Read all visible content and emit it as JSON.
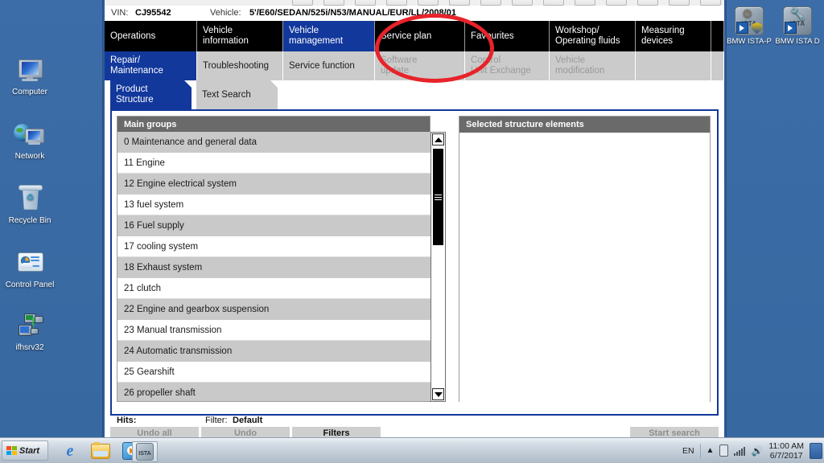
{
  "desktop": {
    "icons_left": [
      {
        "label": "Computer",
        "icon": "computer-icon"
      },
      {
        "label": "Network",
        "icon": "network-icon"
      },
      {
        "label": "Recycle Bin",
        "icon": "recycle-bin-icon"
      },
      {
        "label": "Control Panel",
        "icon": "control-panel-icon"
      },
      {
        "label": "ifhsrv32",
        "icon": "server-shortcut-icon"
      }
    ],
    "icons_right": [
      {
        "label": "BMW ISTA-P",
        "icon": "bmw-ista-p-icon",
        "badge": "ISTA"
      },
      {
        "label": "BMW ISTA D",
        "icon": "bmw-ista-d-icon",
        "badge": "ISTA"
      }
    ]
  },
  "app": {
    "vin_label": "VIN:",
    "vin_value": "CJ95542",
    "vehicle_label": "Vehicle:",
    "vehicle_value": "5'/E60/SEDAN/525i/N53/MANUAL/EUR/LL/2008/01",
    "tabs_main": [
      {
        "label": "Operations",
        "selected": false,
        "disabled": false
      },
      {
        "label": "Vehicle information",
        "selected": false,
        "disabled": false
      },
      {
        "label": "Vehicle management",
        "selected": true,
        "disabled": false
      },
      {
        "label": "Service plan",
        "selected": false,
        "disabled": false
      },
      {
        "label": "Favourites",
        "selected": false,
        "disabled": false
      },
      {
        "label": "Workshop/ Operating fluids",
        "selected": false,
        "disabled": false
      },
      {
        "label": "Measuring devices",
        "selected": false,
        "disabled": false
      }
    ],
    "tabs_sub": [
      {
        "label": "Repair/ Maintenance",
        "selected": true,
        "disabled": false
      },
      {
        "label": "Troubleshooting",
        "selected": false,
        "disabled": false
      },
      {
        "label": "Service function",
        "selected": false,
        "disabled": false
      },
      {
        "label": "Software update",
        "selected": false,
        "disabled": true
      },
      {
        "label": "Control Unit Exchange",
        "selected": false,
        "disabled": true
      },
      {
        "label": "Vehicle modification",
        "selected": false,
        "disabled": true
      }
    ],
    "tabs_inner": [
      {
        "label": "Product Structure",
        "selected": true
      },
      {
        "label": "Text Search",
        "selected": false
      }
    ],
    "left_panel": {
      "header": "Main groups",
      "rows": [
        "0 Maintenance and general data",
        "11 Engine",
        "12 Engine electrical system",
        "13 fuel system",
        "16 Fuel supply",
        "17 cooling system",
        "18 Exhaust system",
        "21 clutch",
        "22 Engine and gearbox suspension",
        "23 Manual transmission",
        "24 Automatic transmission",
        "25 Gearshift",
        "26 propeller shaft"
      ]
    },
    "right_panel": {
      "header": "Selected structure elements",
      "rows": []
    },
    "status": {
      "hits_label": "Hits:",
      "hits_value": "",
      "filter_label": "Filter:",
      "filter_value": "Default"
    },
    "buttons": [
      {
        "label": "Undo all",
        "enabled": false
      },
      {
        "label": "Undo",
        "enabled": false
      },
      {
        "label": "Filters",
        "enabled": true
      },
      {
        "label": "Start search",
        "enabled": false
      }
    ],
    "annotation": {
      "shape": "red-ellipse",
      "color": "#e8232a",
      "targets": "Vehicle management"
    }
  },
  "taskbar": {
    "start_label": "Start",
    "apps": [
      {
        "name": "internet-explorer",
        "active": false
      },
      {
        "name": "windows-explorer",
        "active": false
      },
      {
        "name": "media-player",
        "active": false
      },
      {
        "name": "ista-app",
        "active": true
      }
    ],
    "tray": {
      "language": "EN",
      "time": "11:00 AM",
      "date": "6/7/2017"
    }
  },
  "colors": {
    "accent_blue": "#12389c",
    "tab_black": "#000000",
    "panel_header_gray": "#6a6a6a",
    "annotation_red": "#e8232a",
    "desktop_blue": "#3c6ca8"
  }
}
